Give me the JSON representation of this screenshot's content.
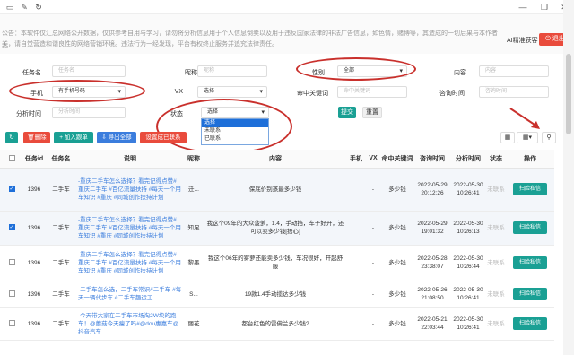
{
  "window": {
    "icons": [
      "folder-icon",
      "edit-icon",
      "refresh-icon",
      "minimize-icon",
      "restore-icon",
      "close-icon"
    ]
  },
  "notice": {
    "line1": "公告：本软件仅汇总网络公开数据，仅供参考自用与学习，请勿将分析信息用于个人信息倒卖以及用于违反国家法律的非法广告信息，如色情，赌博等，其造成的一切后果与本作者无",
    "line2": "关，请自觉营造和谐良性的网络营销环境。违法行为一经发现，平台有权终止服务并追究法律责任。"
  },
  "header": {
    "brand": "AI精准获客",
    "logout": "退出"
  },
  "filters": {
    "task_name": {
      "label": "任务名",
      "placeholder": "任务名"
    },
    "nickname": {
      "label": "昵称",
      "placeholder": "昵称"
    },
    "gender": {
      "label": "性别",
      "value": "全部"
    },
    "content": {
      "label": "内容",
      "placeholder": "内容"
    },
    "phone": {
      "label": "手机",
      "value": "有手机号码"
    },
    "vx": {
      "label": "VX",
      "value": "选择"
    },
    "keyword": {
      "label": "命中关键词",
      "placeholder": "命中关键词"
    },
    "consult_time": {
      "label": "咨询时间",
      "placeholder": "咨询时间"
    },
    "analysis_time": {
      "label": "分析时间",
      "placeholder": "分析时间"
    },
    "status": {
      "label": "状态",
      "value": "选择",
      "options": [
        "选择",
        "未联系",
        "已联系"
      ]
    },
    "submit": "提交",
    "reset": "重置"
  },
  "toolbar": {
    "delete": "删除",
    "add_follow": "加入跟单",
    "export_all": "导出全部",
    "set_contacted": "设置成已联系"
  },
  "table": {
    "headers": [
      "任务id",
      "任务名",
      "说明",
      "昵称",
      "内容",
      "手机",
      "VX",
      "命中关键词",
      "咨询时间",
      "分析时间",
      "状态",
      "操作"
    ],
    "rows": [
      {
        "checked": true,
        "id": "1396",
        "task": "二手车",
        "desc": "-重庆二手车怎么选择？看完记得点赞#重庆二手车 #百亿流量扶持 #每天一个用车知识 #重庆 #同城创作扶持计划",
        "nick": "迁...",
        "content": "保底价别蒸最多少钱",
        "phone": "",
        "vx": "-",
        "kw": "多少钱",
        "consult": "2022-05-29 20:12:26",
        "analysis": "2022-05-30 10:26:41",
        "status": "未联系",
        "op": "扫脸私信"
      },
      {
        "checked": true,
        "id": "1396",
        "task": "二手车",
        "desc": "-重庆二手车怎么选择？看完记得点赞#重庆二手车 #百亿流量扶持 #每天一个用车知识 #重庆 #同城创作扶持计划",
        "nick": "知足",
        "content": "我这个09年的大众菠萝，1.4，手动挡，车子好开，还可以卖多少钱[捂心]",
        "phone": "",
        "vx": "-",
        "kw": "多少钱",
        "consult": "2022-05-29 19:01:32",
        "analysis": "2022-05-30 10:26:13",
        "status": "未联系",
        "op": "扫脸私信"
      },
      {
        "checked": false,
        "id": "1396",
        "task": "二手车",
        "desc": "-重庆二手车怎么选择？看完记得点赞#重庆二手车 #百亿流量扶持 #每天一个用车知识 #重庆 #同城创作扶持计划",
        "nick": "黎墨",
        "content": "我这个06年的雾萝还能卖多少钱，车况很好，开起舒服",
        "phone": "",
        "vx": "-",
        "kw": "多少钱",
        "consult": "2022-05-28 23:38:07",
        "analysis": "2022-05-30 10:26:44",
        "status": "未联系",
        "op": "扫脸私信"
      },
      {
        "checked": false,
        "id": "1396",
        "task": "二手车",
        "desc": "-二手车怎么选，二手车常识#二手车 #每天一辆代步车 #二手车趣运工",
        "nick": "S...",
        "content": "19款1.4手动揽达多少钱",
        "phone": "",
        "vx": "-",
        "kw": "多少钱",
        "consult": "2022-05-26 21:08:50",
        "analysis": "2022-05-30 10:26:41",
        "status": "未联系",
        "op": "扫脸私信"
      },
      {
        "checked": false,
        "id": "1396",
        "task": "二手车",
        "desc": "-今天带大家在二手车市场淘2W块的跑车！@蘑菇今天瘦了吗#@dou惠嘉车@抖音汽车",
        "nick": "丽花",
        "content": "都台红色的雷佛兰多少钱?",
        "phone": "",
        "vx": "-",
        "kw": "多少钱",
        "consult": "2022-05-21 22:03:44",
        "analysis": "2022-05-30 10:26:41",
        "status": "未联系",
        "op": "扫脸私信"
      }
    ]
  },
  "colors": {
    "accent": "#1aa094",
    "danger": "#e94b3c",
    "annotation": "#c9302c",
    "link": "#3b7ddd"
  }
}
